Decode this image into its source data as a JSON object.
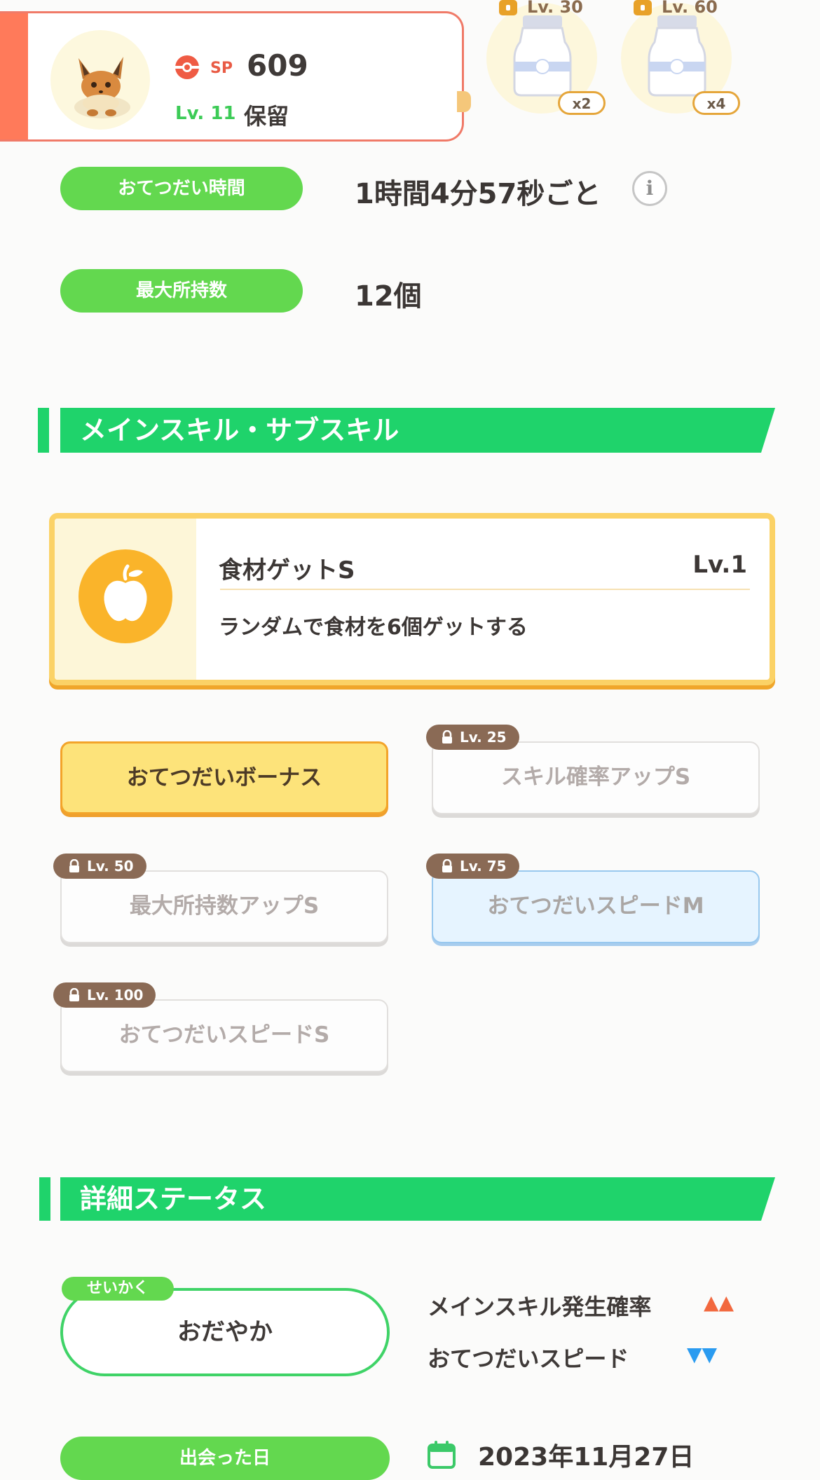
{
  "header": {
    "sp_label": "SP",
    "sp_value": "609",
    "level": "Lv. 11",
    "status": "保留",
    "unlocks": [
      {
        "level": "Lv. 30",
        "multiplier": "x2"
      },
      {
        "level": "Lv. 60",
        "multiplier": "x4"
      }
    ]
  },
  "info": {
    "help_time": {
      "label": "おてつだい時間",
      "value": "1時間4分57秒ごと"
    },
    "max_carry": {
      "label": "最大所持数",
      "value": "12個"
    }
  },
  "skills_section": {
    "title": "メインスキル・サブスキル",
    "main_skill": {
      "name": "食材ゲットS",
      "level": "Lv.1",
      "description": "ランダムで食材を6個ゲットする"
    },
    "sub_skills": [
      {
        "name": "おてつだいボーナス",
        "lock": ""
      },
      {
        "name": "スキル確率アップS",
        "lock": "Lv. 25"
      },
      {
        "name": "最大所持数アップS",
        "lock": "Lv. 50"
      },
      {
        "name": "おてつだいスピードM",
        "lock": "Lv. 75"
      },
      {
        "name": "おてつだいスピードS",
        "lock": "Lv. 100"
      }
    ]
  },
  "detail_section": {
    "title": "詳細ステータス",
    "nature_tag": "せいかく",
    "nature": "おだやか",
    "up_effect": "メインスキル発生確率",
    "up_arrows": "▲▲",
    "down_effect": "おてつだいスピード",
    "down_arrows": "▼▼",
    "met_label": "出会った日",
    "met_date": "2023年11月27日"
  },
  "colors": {
    "accent_green": "#1fd36b",
    "pill_green": "#63d84f",
    "up_color": "#f2683e",
    "down_color": "#2a9bf0"
  }
}
